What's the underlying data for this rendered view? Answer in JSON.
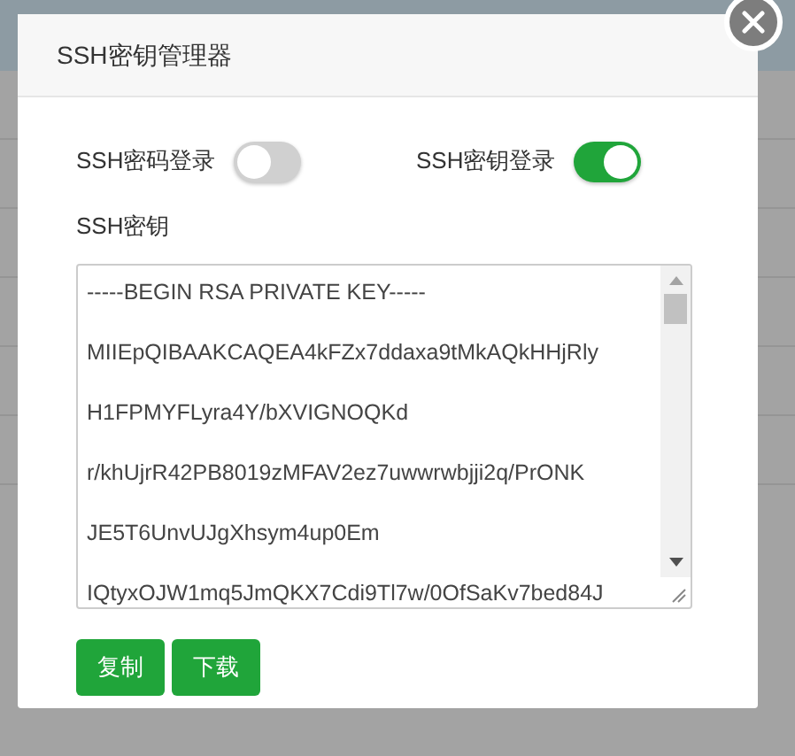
{
  "dialog": {
    "title": "SSH密钥管理器",
    "toggles": [
      {
        "label": "SSH密码登录",
        "on": false
      },
      {
        "label": "SSH密钥登录",
        "on": true
      }
    ],
    "key_field": {
      "label": "SSH密钥",
      "lines": [
        "-----BEGIN RSA PRIVATE KEY-----",
        "MIIEpQIBAAKCAQEA4kFZx7ddaxa9tMkAQkHHjRly",
        "H1FPMYFLyra4Y/bXVIGNOQKd",
        "r/khUjrR42PB8019zMFAV2ez7uwwrwbjji2q/PrONK",
        "JE5T6UnvUJgXhsym4up0Em",
        "IQtyxOJW1mq5JmQKX7Cdi9Tl7w/0OfSaKv7bed84J"
      ]
    },
    "buttons": [
      "复制",
      "下载"
    ]
  }
}
